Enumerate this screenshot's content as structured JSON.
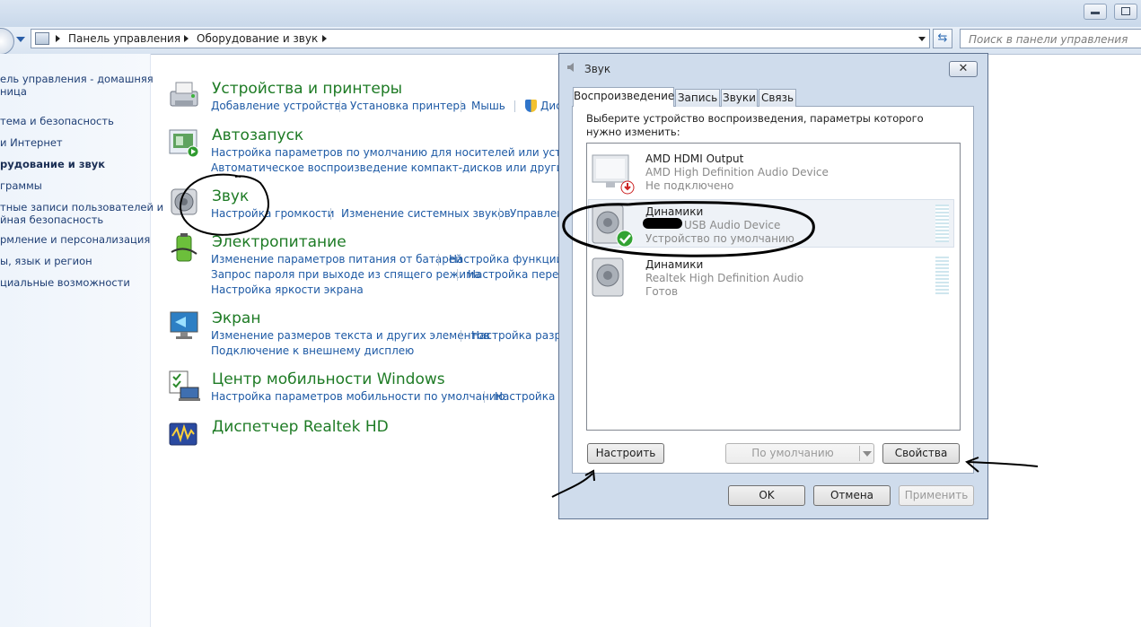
{
  "address": {
    "breadcrumbs": [
      "Панель управления",
      "Оборудование и звук"
    ],
    "search_placeholder": "Поиск в панели управления"
  },
  "left_nav": {
    "items": [
      {
        "line1": "ель управления - домашняя",
        "line2": "ница",
        "bold": false
      },
      {
        "line1": "тема и безопасность",
        "bold": false
      },
      {
        "line1": "и Интернет",
        "bold": false
      },
      {
        "line1": "рудование и звук",
        "bold": true
      },
      {
        "line1": "граммы",
        "bold": false
      },
      {
        "line1": "тные записи пользователей и",
        "line2": "йная безопасность",
        "bold": false
      },
      {
        "line1": "рмление и персонализация",
        "bold": false
      },
      {
        "line1": "ы, язык и регион",
        "bold": false
      },
      {
        "line1": "циальные возможности",
        "bold": false
      }
    ]
  },
  "sections": [
    {
      "title": "Устройства и принтеры",
      "links": [
        "Добавление устройства",
        "Установка принтера",
        "Мышь",
        "Дис"
      ]
    },
    {
      "title": "Автозапуск",
      "links": [
        "Настройка параметров по умолчанию для носителей или устройств",
        "Автоматическое воспроизведение компакт-дисков или других носите"
      ]
    },
    {
      "title": "Звук",
      "links": [
        "Настройка громкости",
        "Изменение системных звуков",
        "Управлен"
      ]
    },
    {
      "title": "Электропитание",
      "links": [
        "Изменение параметров питания от батарей",
        "Настройка функций к",
        "Запрос пароля при выходе из спящего режима",
        "Настройка перехо",
        "Настройка яркости экрана"
      ]
    },
    {
      "title": "Экран",
      "links": [
        "Изменение размеров текста и других элементов",
        "Настройка разре",
        "Подключение к внешнему дисплею"
      ]
    },
    {
      "title": "Центр мобильности Windows",
      "links": [
        "Настройка параметров мобильности по умолчанию",
        "Настройка па"
      ]
    },
    {
      "title": "Диспетчер Realtek HD",
      "links": []
    }
  ],
  "dialog": {
    "title": "Звук",
    "close_label": "✕",
    "tabs": [
      "Воспроизведение",
      "Запись",
      "Звуки",
      "Связь"
    ],
    "instructions": "Выберите устройство воспроизведения, параметры которого нужно изменить:",
    "devices": [
      {
        "name": "AMD HDMI Output",
        "driver": "AMD High Definition Audio Device",
        "status": "Не подключено"
      },
      {
        "name": "Динамики",
        "driver": "USB Audio Device",
        "status": "Устройство по умолчанию"
      },
      {
        "name": "Динамики",
        "driver": "Realtek High Definition Audio",
        "status": "Готов"
      }
    ],
    "buttons": {
      "configure": "Настроить",
      "default": "По умолчанию",
      "properties": "Свойства",
      "ok": "OK",
      "cancel": "Отмена",
      "apply": "Применить"
    }
  },
  "colors": {
    "link": "#1e5aa5",
    "section_title": "#1e7b25",
    "dialog_bg": "#cfdcec"
  }
}
